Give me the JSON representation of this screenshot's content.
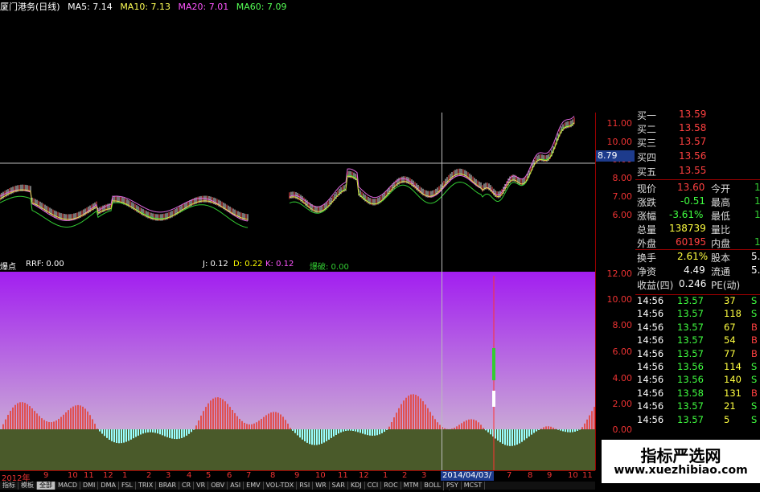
{
  "header": {
    "title": "厦门港务(日线)",
    "ma": [
      {
        "label": "MA5: 7.14",
        "color": "#ffffff"
      },
      {
        "label": "MA10: 7.13",
        "color": "#ffff55"
      },
      {
        "label": "MA20: 7.01",
        "color": "#ff55ff"
      },
      {
        "label": "MA60: 7.09",
        "color": "#55ff55"
      }
    ]
  },
  "price_axis": [
    "11.00",
    "10.00",
    "9.00",
    "8.00",
    "7.00",
    "6.00"
  ],
  "price_cursor": "8.79",
  "indicator_bar": {
    "name": "爆点",
    "rrf": "RRF: 0.00",
    "j": "J: 0.12",
    "d": "D: 0.22",
    "k": "K: 0.12",
    "last": "爆破: 0.00"
  },
  "ind_axis": [
    "12.00",
    "10.00",
    "8.00",
    "6.00",
    "4.00",
    "2.00",
    "0.00"
  ],
  "x_axis": [
    "2012年",
    "9",
    "10",
    "11",
    "12",
    "1",
    "2",
    "3",
    "4",
    "5",
    "6",
    "7",
    "8",
    "9",
    "10",
    "11",
    "12",
    "1",
    "2",
    "3",
    "7",
    "8",
    "9",
    "10",
    "11"
  ],
  "date_cursor": "2014/04/03/四",
  "tabs": [
    "指标",
    "模板",
    "全部",
    "MACD",
    "DMI",
    "DMA",
    "FSL",
    "TRIX",
    "BRAR",
    "CR",
    "VR",
    "OBV",
    "ASI",
    "EMV",
    "VOL-TDX",
    "RSI",
    "WR",
    "SAR",
    "KDJ",
    "CCI",
    "ROC",
    "MTM",
    "BOLL",
    "PSY",
    "MCST"
  ],
  "active_tab": "全部",
  "order_book": [
    {
      "label": "买一",
      "price": "13.59"
    },
    {
      "label": "买二",
      "price": "13.58"
    },
    {
      "label": "买三",
      "price": "13.57"
    },
    {
      "label": "买四",
      "price": "13.56"
    },
    {
      "label": "买五",
      "price": "13.55"
    }
  ],
  "stats": [
    {
      "l1": "现价",
      "v1": "13.60",
      "l2": "今开",
      "v2": "1",
      "c1": "#ff4040"
    },
    {
      "l1": "涨跌",
      "v1": "-0.51",
      "l2": "最高",
      "v2": "1",
      "c1": "#40ff40"
    },
    {
      "l1": "涨幅",
      "v1": "-3.61%",
      "l2": "最低",
      "v2": "1",
      "c1": "#40ff40"
    },
    {
      "l1": "总量",
      "v1": "138739",
      "l2": "量比",
      "v2": "",
      "c1": "#ffff40"
    },
    {
      "l1": "外盘",
      "v1": "60195",
      "l2": "内盘",
      "v2": "1",
      "c1": "#ff4040"
    }
  ],
  "fundamentals": [
    {
      "l1": "换手",
      "v1": "2.61%",
      "l2": "股本",
      "v2": "5."
    },
    {
      "l1": "净资",
      "v1": "4.49",
      "l2": "流通",
      "v2": "5."
    },
    {
      "l1": "收益(四)",
      "v1": "0.246",
      "l2": "PE(动)",
      "v2": ""
    }
  ],
  "ticks": [
    {
      "time": "14:56",
      "price": "13.57",
      "vol": "37",
      "side": "S"
    },
    {
      "time": "14:56",
      "price": "13.57",
      "vol": "118",
      "side": "S"
    },
    {
      "time": "14:56",
      "price": "13.57",
      "vol": "67",
      "side": "B"
    },
    {
      "time": "14:56",
      "price": "13.57",
      "vol": "54",
      "side": "B"
    },
    {
      "time": "14:56",
      "price": "13.57",
      "vol": "77",
      "side": "B"
    },
    {
      "time": "14:56",
      "price": "13.56",
      "vol": "114",
      "side": "S"
    },
    {
      "time": "14:56",
      "price": "13.56",
      "vol": "140",
      "side": "S"
    },
    {
      "time": "14:56",
      "price": "13.58",
      "vol": "131",
      "side": "B"
    },
    {
      "time": "14:56",
      "price": "13.57",
      "vol": "21",
      "side": "S"
    },
    {
      "time": "14:56",
      "price": "13.57",
      "vol": "5",
      "side": "S"
    }
  ],
  "watermark": {
    "cn": "指标严选网",
    "url": "www.xuezhibiao.com"
  }
}
